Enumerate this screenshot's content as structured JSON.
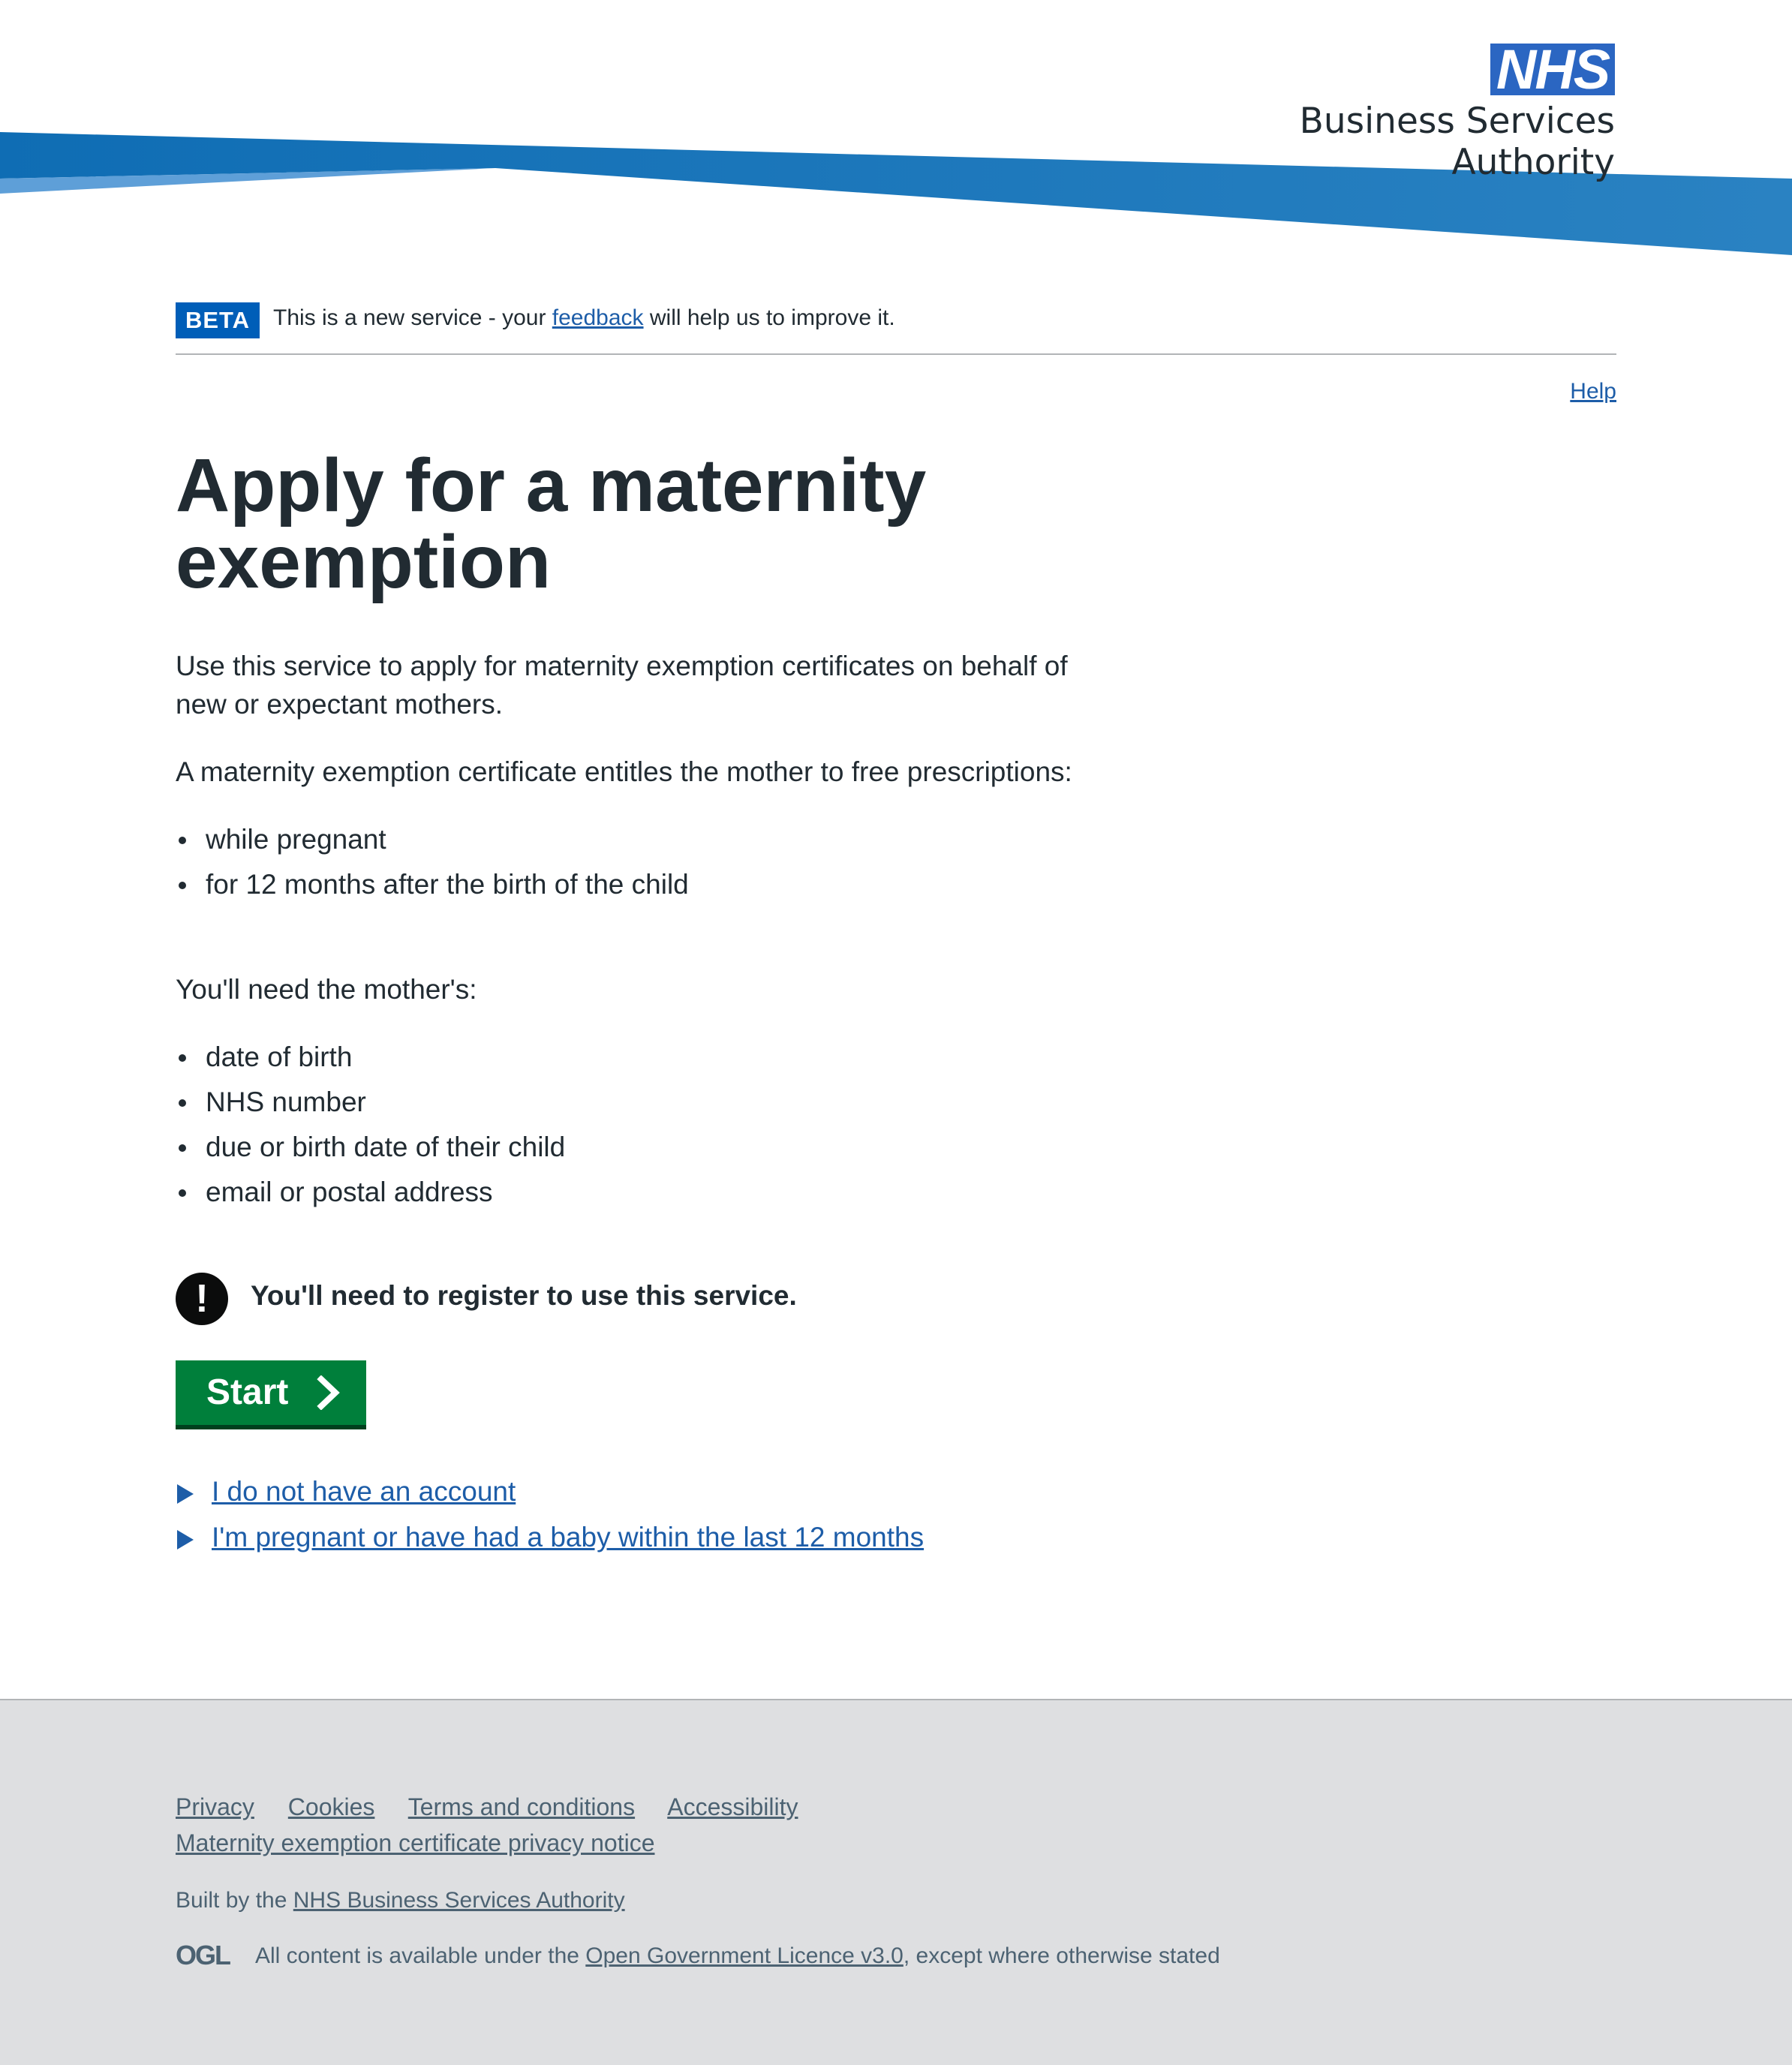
{
  "header": {
    "logo_mark": "NHS",
    "logo_text": "Business Services Authority"
  },
  "phase_banner": {
    "tag": "BETA",
    "text_before": "This is a new service - your ",
    "link": "feedback",
    "text_after": " will help us to improve it."
  },
  "help_link": "Help",
  "title": "Apply for a maternity exemption",
  "intro": "Use this service to apply for maternity exemption certificates on behalf of new or expectant mothers.",
  "entitles": "A maternity exemption certificate entitles the mother to free prescriptions:",
  "entitle_items": [
    "while pregnant",
    "for 12 months after the birth of the child"
  ],
  "need_intro": "You'll need the mother's:",
  "need_items": [
    "date of birth",
    "NHS number",
    "due or birth date of their child",
    "email or postal address"
  ],
  "warning": {
    "icon": "!",
    "text": "You'll need to register to use this service."
  },
  "start_button": "Start",
  "details": [
    "I do not have an account",
    "I'm pregnant or have had a baby within the last 12 months"
  ],
  "footer": {
    "links": [
      "Privacy",
      "Cookies",
      "Terms and conditions",
      "Accessibility"
    ],
    "link2": "Maternity exemption certificate privacy notice",
    "built_prefix": "Built by the ",
    "built_link": "NHS Business Services Authority",
    "ogl_logo": "OGL",
    "licence_prefix": "All content is available under the ",
    "licence_link": "Open Government Licence v3.0",
    "licence_suffix": ", except where otherwise stated"
  },
  "colors": {
    "nhs_blue": "#2b66c2",
    "link": "#1d5da8",
    "start_green": "#007f3b",
    "footer_bg": "#dedfe1"
  }
}
